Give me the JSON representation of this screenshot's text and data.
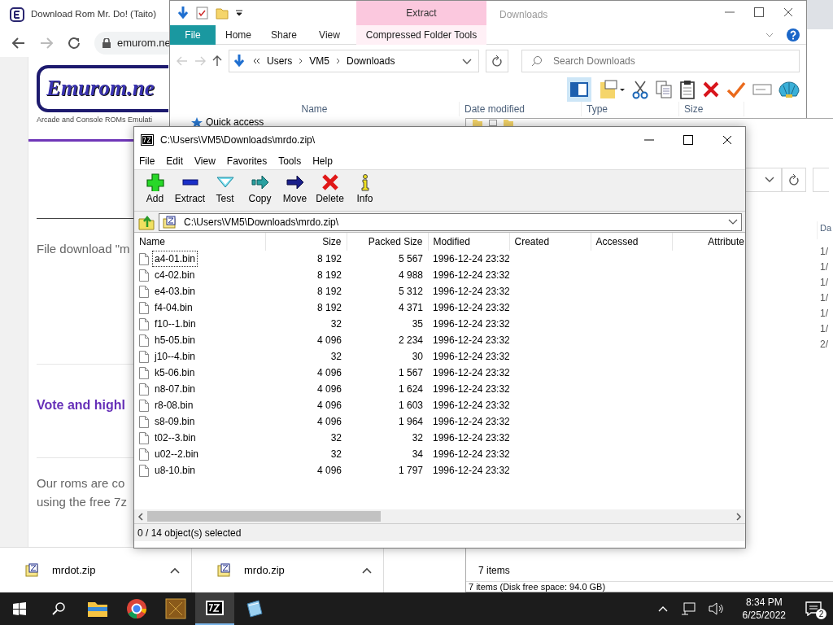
{
  "browser": {
    "tab_title": "Download Rom Mr. Do! (Taito)",
    "url": "emurom.ne",
    "logo": "Emurom.ne",
    "tagline": "Arcade and Console ROMs Emulati",
    "blocks": [
      {
        "kind": "paragraph",
        "text": "File download \"m"
      },
      {
        "kind": "heading",
        "text": "Vote and highl"
      },
      {
        "kind": "paragraph",
        "text": "Our roms are co"
      },
      {
        "kind": "paragraph",
        "text": "using the free 7z"
      }
    ],
    "downloads": [
      {
        "name": "mrdot.zip"
      },
      {
        "name": "mrdo.zip"
      }
    ]
  },
  "explorer": {
    "context_group": "Extract",
    "title": "Downloads",
    "tabs": [
      {
        "label": "File",
        "kind": "file"
      },
      {
        "label": "Home",
        "kind": "plain"
      },
      {
        "label": "Share",
        "kind": "plain"
      },
      {
        "label": "View",
        "kind": "plain"
      },
      {
        "label": "Compressed Folder Tools",
        "kind": "context"
      }
    ],
    "breadcrumb": [
      "Users",
      "VM5",
      "Downloads"
    ],
    "search": {
      "placeholder": "Search Downloads"
    },
    "columns": [
      "Name",
      "Date modified",
      "Type",
      "Size"
    ],
    "nav_item": "Quick access"
  },
  "explorer_behind": {
    "column": "Da",
    "dates": [
      "1/",
      "1/",
      "1/",
      "1/",
      "1/",
      "1/",
      "2/"
    ],
    "item_count": "7 items",
    "status": "7 items (Disk free space: 94.0 GB)"
  },
  "sevenzip": {
    "title": "C:\\Users\\VM5\\Downloads\\mrdo.zip\\",
    "menu": [
      "File",
      "Edit",
      "View",
      "Favorites",
      "Tools",
      "Help"
    ],
    "tools": [
      {
        "label": "Add",
        "kind": "add"
      },
      {
        "label": "Extract",
        "kind": "extract"
      },
      {
        "label": "Test",
        "kind": "test"
      },
      {
        "label": "Copy",
        "kind": "copy"
      },
      {
        "label": "Move",
        "kind": "move"
      },
      {
        "label": "Delete",
        "kind": "delete"
      },
      {
        "label": "Info",
        "kind": "info"
      }
    ],
    "path": "C:\\Users\\VM5\\Downloads\\mrdo.zip\\",
    "columns": [
      "Name",
      "Size",
      "Packed Size",
      "Modified",
      "Created",
      "Accessed",
      "Attribute"
    ],
    "rows": [
      {
        "name": "a4-01.bin",
        "size": "8 192",
        "packed": "5 567",
        "modified": "1996-12-24 23:32",
        "focused": true
      },
      {
        "name": "c4-02.bin",
        "size": "8 192",
        "packed": "4 988",
        "modified": "1996-12-24 23:32",
        "focused": false
      },
      {
        "name": "e4-03.bin",
        "size": "8 192",
        "packed": "5 312",
        "modified": "1996-12-24 23:32",
        "focused": false
      },
      {
        "name": "f4-04.bin",
        "size": "8 192",
        "packed": "4 371",
        "modified": "1996-12-24 23:32",
        "focused": false
      },
      {
        "name": "f10--1.bin",
        "size": "32",
        "packed": "35",
        "modified": "1996-12-24 23:32",
        "focused": false
      },
      {
        "name": "h5-05.bin",
        "size": "4 096",
        "packed": "2 234",
        "modified": "1996-12-24 23:32",
        "focused": false
      },
      {
        "name": "j10--4.bin",
        "size": "32",
        "packed": "30",
        "modified": "1996-12-24 23:32",
        "focused": false
      },
      {
        "name": "k5-06.bin",
        "size": "4 096",
        "packed": "1 567",
        "modified": "1996-12-24 23:32",
        "focused": false
      },
      {
        "name": "n8-07.bin",
        "size": "4 096",
        "packed": "1 624",
        "modified": "1996-12-24 23:32",
        "focused": false
      },
      {
        "name": "r8-08.bin",
        "size": "4 096",
        "packed": "1 603",
        "modified": "1996-12-24 23:32",
        "focused": false
      },
      {
        "name": "s8-09.bin",
        "size": "4 096",
        "packed": "1 964",
        "modified": "1996-12-24 23:32",
        "focused": false
      },
      {
        "name": "t02--3.bin",
        "size": "32",
        "packed": "32",
        "modified": "1996-12-24 23:32",
        "focused": false
      },
      {
        "name": "u02--2.bin",
        "size": "32",
        "packed": "34",
        "modified": "1996-12-24 23:32",
        "focused": false
      },
      {
        "name": "u8-10.bin",
        "size": "4 096",
        "packed": "1 797",
        "modified": "1996-12-24 23:32",
        "focused": false
      }
    ],
    "status": "0 / 14 object(s) selected"
  },
  "taskbar": {
    "apps": [
      {
        "kind": "explorer",
        "active": false
      },
      {
        "kind": "chrome",
        "active": false
      },
      {
        "kind": "dos",
        "active": false
      },
      {
        "kind": "sevenzip",
        "active": true
      },
      {
        "kind": "notepad",
        "active": false
      }
    ],
    "time": "8:34 PM",
    "date": "6/25/2022",
    "notifications": "2"
  }
}
